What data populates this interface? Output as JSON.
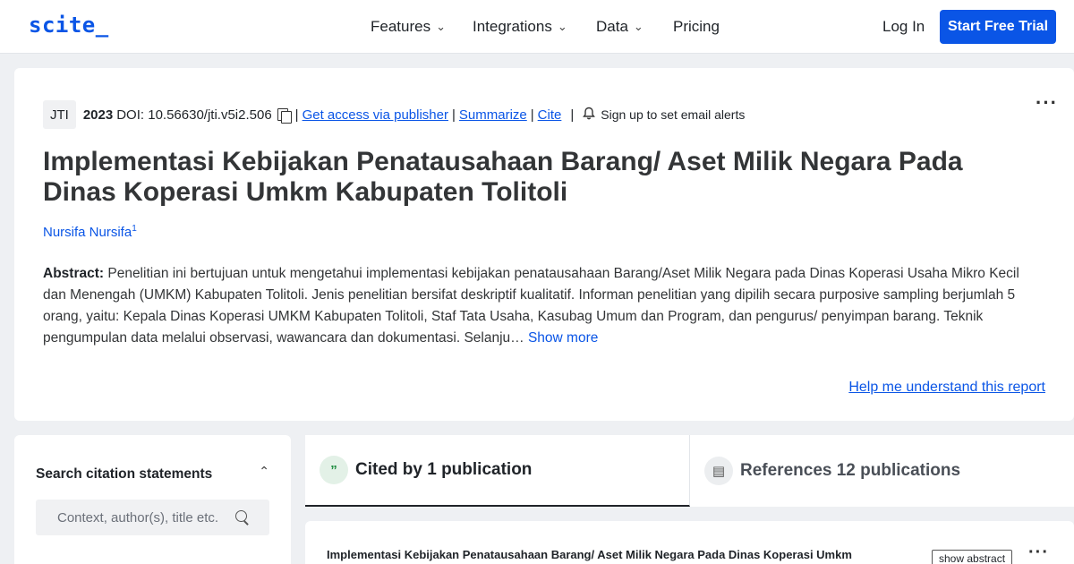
{
  "header": {
    "logo": "scite_",
    "nav": {
      "features": "Features",
      "integrations": "Integrations",
      "data": "Data",
      "pricing": "Pricing"
    },
    "login": "Log In",
    "trial": "Start Free Trial"
  },
  "paper": {
    "journal": "JTI",
    "year": "2023",
    "doi": "DOI: 10.56630/jti.v5i2.506",
    "access_link": "Get access via publisher",
    "summarize_link": "Summarize",
    "cite_link": "Cite",
    "alerts": "Sign up to set email alerts",
    "title": "Implementasi Kebijakan Penatausahaan Barang/ Aset Milik Negara Pada Dinas Koperasi Umkm Kabupaten Tolitoli",
    "author": "Nursifa Nursifa",
    "author_sup": "1",
    "abstract_label": "Abstract:",
    "abstract_text": "Penelitian ini bertujuan untuk mengetahui implementasi kebijakan penatausahaan Barang/Aset Milik Negara pada Dinas Koperasi Usaha Mikro Kecil dan Menengah (UMKM) Kabupaten Tolitoli. Jenis penelitian bersifat deskriptif kualitatif. Informan penelitian yang dipilih secara purposive sampling berjumlah 5 orang, yaitu: Kepala Dinas Koperasi UMKM Kabupaten Tolitoli, Staf Tata Usaha, Kasubag Umum dan Program, dan pengurus/ penyimpan barang. Teknik pengumpulan data melalui observasi, wawancara dan dokumentasi. Selanju…",
    "show_more": "Show more",
    "help": "Help me understand this report"
  },
  "sidebar": {
    "title": "Search citation statements",
    "search_placeholder": "Context, author(s), title etc."
  },
  "tabs": {
    "cited": "Cited by 1 publication",
    "references": "References 12 publications"
  },
  "result": {
    "title": "Implementasi Kebijakan Penatausahaan Barang/ Aset Milik Negara Pada Dinas Koperasi Umkm",
    "show_abstract": "show abstract"
  },
  "colors": {
    "accent": "#0a55e6",
    "background": "#eef0f3"
  }
}
